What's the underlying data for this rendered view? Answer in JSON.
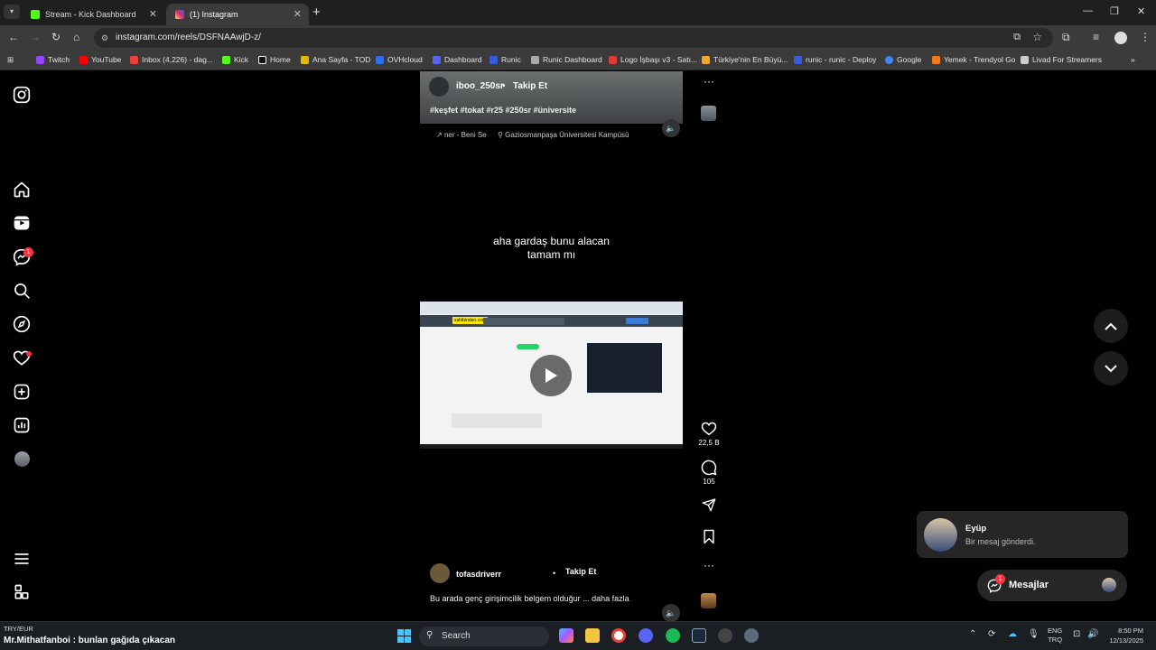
{
  "browser": {
    "tabs": [
      {
        "title": "Stream - Kick Dashboard",
        "color": "#53fc18"
      },
      {
        "title": "(1) Instagram",
        "color": "#d62976"
      }
    ],
    "new_tab": "+",
    "url": "instagram.com/reels/DSFNAAwjD-z/",
    "bookmarks": [
      {
        "label": "Twitch",
        "color": "#9146ff"
      },
      {
        "label": "YouTube",
        "color": "#ff0000"
      },
      {
        "label": "Inbox (4,226) - dag...",
        "color": "#ea4335"
      },
      {
        "label": "Kick",
        "color": "#53fc18"
      },
      {
        "label": "Home",
        "color": "#ffffff"
      },
      {
        "label": "Ana Sayfa - TOD",
        "color": "#e5b800"
      },
      {
        "label": "OVHcloud",
        "color": "#2f6ee6"
      },
      {
        "label": "Dashboard",
        "color": "#5865f2"
      },
      {
        "label": "Runic",
        "color": "#3a5bd9"
      },
      {
        "label": "Runic Dashboard",
        "color": "#aaaaaa"
      },
      {
        "label": "Logo İşbaşı v3 - Satı...",
        "color": "#e03a3a"
      },
      {
        "label": "Türkiye'nin En Büyü...",
        "color": "#f5a623"
      },
      {
        "label": "runic - runic - Deploy",
        "color": "#3b5bdb"
      },
      {
        "label": "Google",
        "color": "#4285f4"
      },
      {
        "label": "Yemek - Trendyol Go",
        "color": "#f27a1a"
      },
      {
        "label": "Livad For Streamers",
        "color": "#cccccc"
      }
    ]
  },
  "sidebar": {
    "notifications_badge": "1"
  },
  "reel": {
    "top_user": "iboo_250sr",
    "top_follow": "Takip Et",
    "hashtags": "#keşfet #tokat #r25 #250sr #üniversite",
    "audio": "ner - Beni Se",
    "location": "Gaziosmanpaşa Üniversitesi Kampüsü",
    "overlay_text_line1": "aha gardaş bunu alacan",
    "overlay_text_line2": "tamam mı",
    "embed_site": "sahibinden.com",
    "bottom_user": "tofasdriverr",
    "bottom_follow": "Takip Et",
    "caption": "Bu arada genç girişimcilik belgem olduğur ... daha fazla",
    "caption_more": "daha fazla"
  },
  "actions": {
    "likes": "22,5 B",
    "comments": "105"
  },
  "notification": {
    "name": "Eyüp",
    "text": "Bir mesaj gönderdi."
  },
  "messages": {
    "label": "Mesajlar",
    "badge": "1"
  },
  "taskbar": {
    "ticker_top": "TRY/EUR",
    "ticker_bottom": "Mr.Mithatfanboi : bunlan gağıda çıkacan",
    "search": "Search",
    "lang1": "ENG",
    "lang2": "TRQ",
    "time": "8:50 PM",
    "date": "12/13/2025"
  }
}
